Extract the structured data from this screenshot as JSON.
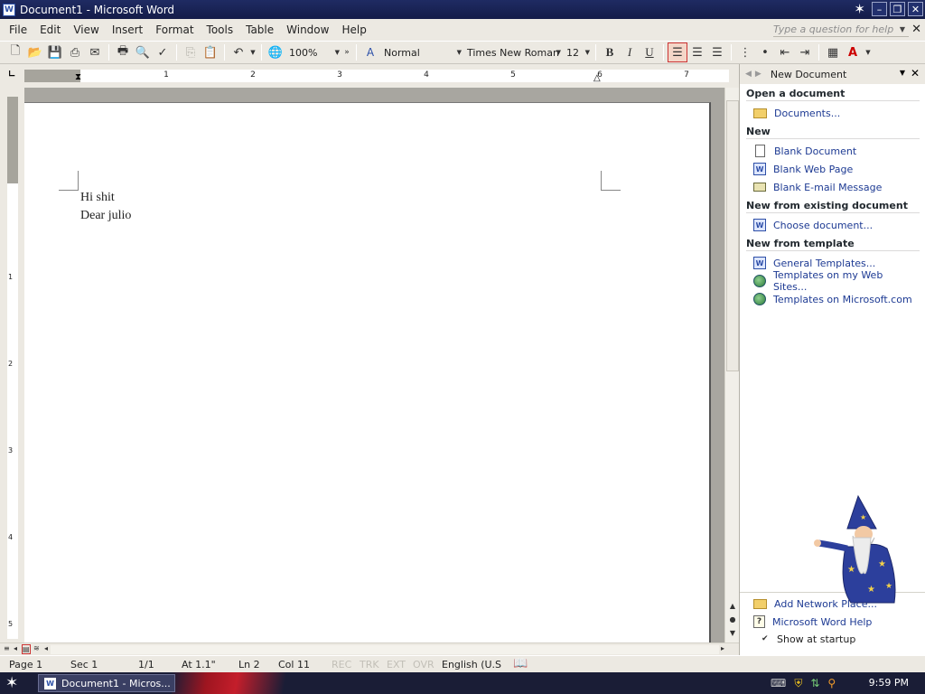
{
  "window": {
    "title": "Document1 - Microsoft Word",
    "app_icon": "word-icon"
  },
  "menus": [
    "File",
    "Edit",
    "View",
    "Insert",
    "Format",
    "Tools",
    "Table",
    "Window",
    "Help"
  ],
  "ask_box": {
    "placeholder": "Type a question for help"
  },
  "toolbar": {
    "zoom": "100%",
    "style": "Normal",
    "font": "Times New Roman",
    "font_size": "12",
    "bold_label": "B",
    "italic_label": "I",
    "underline_label": "U",
    "alignment_active": "align-left"
  },
  "ruler": {
    "numbers": [
      "1",
      "2",
      "3",
      "4",
      "5",
      "6",
      "7"
    ],
    "vertical_numbers": [
      "1",
      "2",
      "3",
      "4",
      "5"
    ]
  },
  "document": {
    "lines": [
      "Hi shit",
      "Dear julio"
    ]
  },
  "task_pane": {
    "title": "New Document",
    "sections": [
      {
        "heading": "Open a document",
        "links": [
          {
            "label": "Documents...",
            "icon": "folder-icon"
          }
        ]
      },
      {
        "heading": "New",
        "links": [
          {
            "label": "Blank Document",
            "icon": "blank-doc-icon"
          },
          {
            "label": "Blank Web Page",
            "icon": "web-page-icon"
          },
          {
            "label": "Blank E-mail Message",
            "icon": "email-icon"
          }
        ]
      },
      {
        "heading": "New from existing document",
        "links": [
          {
            "label": "Choose document...",
            "icon": "word-doc-icon"
          }
        ]
      },
      {
        "heading": "New from template",
        "links": [
          {
            "label": "General Templates...",
            "icon": "word-doc-icon"
          },
          {
            "label": "Templates on my Web Sites...",
            "icon": "web-templates-icon"
          },
          {
            "label": "Templates on Microsoft.com",
            "icon": "globe-icon"
          }
        ]
      }
    ],
    "bottom_links": [
      {
        "label": "Add Network Place...",
        "icon": "folder-icon"
      },
      {
        "label": "Microsoft Word Help",
        "icon": "help-icon"
      }
    ],
    "show_at_startup": {
      "label": "Show at startup",
      "checked": true
    }
  },
  "status_bar": {
    "page": "Page 1",
    "sec": "Sec 1",
    "pages": "1/1",
    "at": "At 1.1\"",
    "ln": "Ln 2",
    "col": "Col 11",
    "rec": "REC",
    "trk": "TRK",
    "ext": "EXT",
    "ovr": "OVR",
    "language": "English (U.S"
  },
  "taskbar": {
    "task_label": "Document1 - Micros...",
    "clock": "9:59 PM"
  },
  "colors": {
    "title_bar": "#1f2b63",
    "link": "#1d3a93",
    "active_toggle_border": "#cc3333"
  }
}
